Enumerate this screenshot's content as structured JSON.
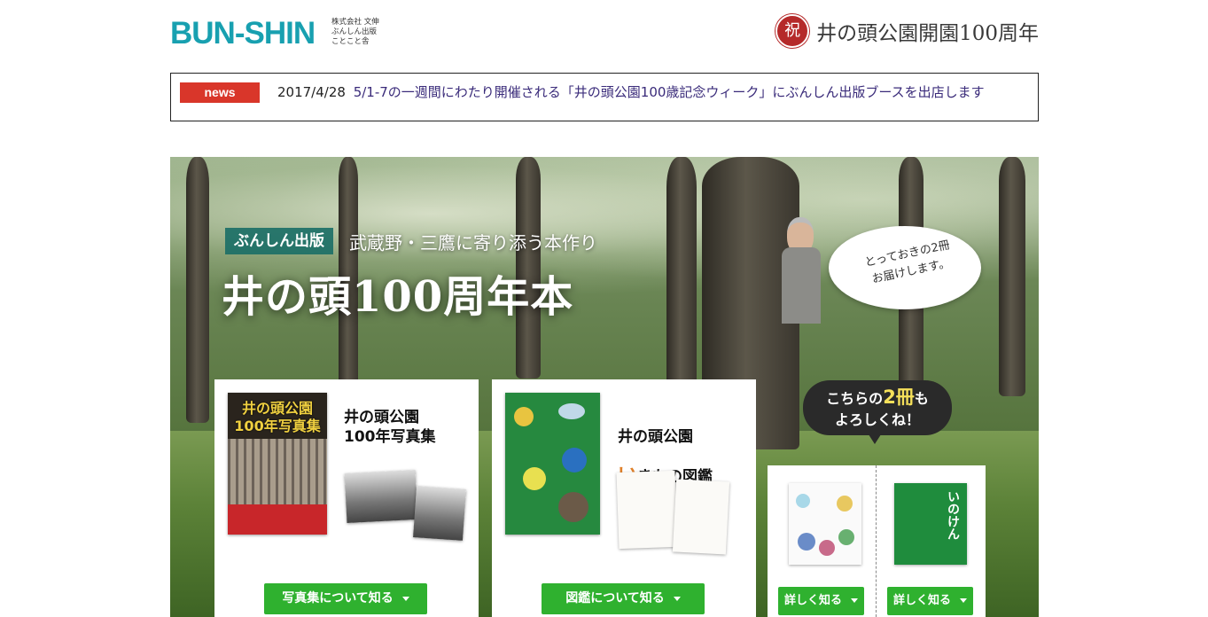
{
  "header": {
    "logo": "BUN-SHIN",
    "logo_sub": "株式会社 文伸\nぶんしん出版\nことこと舎",
    "iwai_mark": "祝",
    "centennial": "井の頭公園開園100周年"
  },
  "news": {
    "badge": "news",
    "date": "2017/4/28",
    "text": "5/1-7の一週間にわたり開催される「井の頭公園100歳記念ウィーク」にぶんしん出版ブースを出店します"
  },
  "hero": {
    "badge": "ぶんしん出版",
    "tagline": "武蔵野・三鷹に寄り添う本作り",
    "title": "井の頭100周年本",
    "bubble": "とっておきの2冊\nお届けします。",
    "dark_bubble": {
      "line1_pre": "こちらの",
      "line1_big": "2冊",
      "line1_post": "も",
      "line2": "よろしくね！"
    }
  },
  "books": [
    {
      "cover_title": "井の頭公園\n100年写真集",
      "title": "井の頭公園\n100年写真集",
      "button": "写真集について知る"
    },
    {
      "title_line1": "井の頭公園",
      "title_line2a": "い",
      "title_line2b": "きもの図鑑",
      "button": "図鑑について知る"
    }
  ],
  "small_books": {
    "cover2_title": "いのけん",
    "button1": "詳しく知る",
    "button2": "詳しく知る"
  },
  "colors": {
    "brand": "#18a0b0",
    "news_badge": "#d9362a",
    "button": "#2fb12f"
  }
}
